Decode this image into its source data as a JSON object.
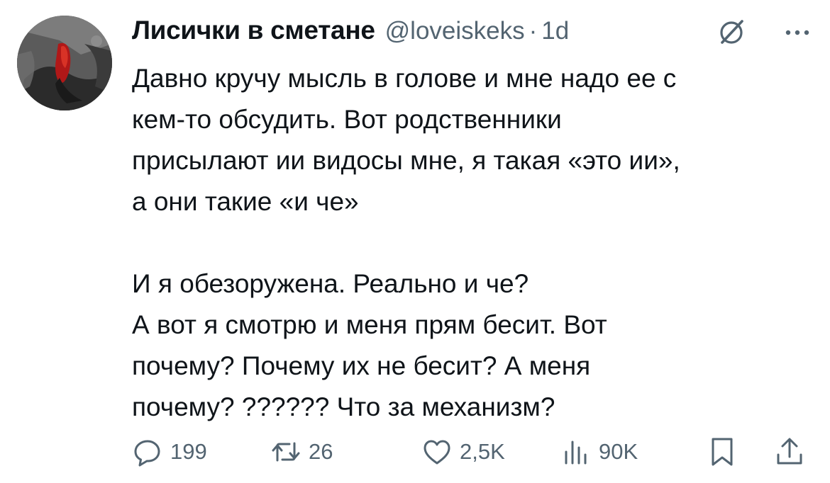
{
  "author": {
    "display_name": "Лисички в сметане",
    "handle": "@loveiskeks",
    "separator": "·",
    "time": "1d"
  },
  "header_icons": {
    "grok": "grok-icon",
    "more": "more-icon"
  },
  "tweet": {
    "paragraph_1": "Давно кручу мысль в голове и мне надо ее с\nкем-то обсудить. Вот родственники\nприсылают ии видосы мне, я такая «это ии»,\nа они такие «и че»",
    "paragraph_2": "И я обезоружена. Реально и че?\nА вот я смотрю и меня прям бесит. Вот\nпочему? Почему их не бесит? А меня\nпочему? ?????? Что за механизм?"
  },
  "actions": {
    "reply": {
      "icon": "reply-icon",
      "count": "199"
    },
    "retweet": {
      "icon": "retweet-icon",
      "count": "26"
    },
    "like": {
      "icon": "heart-icon",
      "count": "2,5K"
    },
    "views": {
      "icon": "views-icon",
      "count": "90K"
    },
    "bookmark": {
      "icon": "bookmark-icon"
    },
    "share": {
      "icon": "share-icon"
    }
  },
  "colors": {
    "text": "#0f1419",
    "secondary": "#536471",
    "background": "#ffffff"
  }
}
